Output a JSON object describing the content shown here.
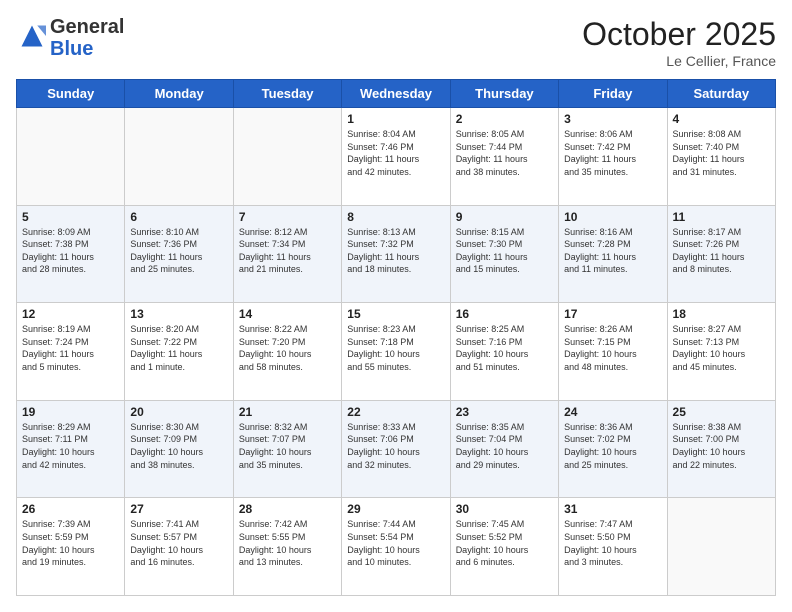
{
  "header": {
    "logo_general": "General",
    "logo_blue": "Blue",
    "month_title": "October 2025",
    "location": "Le Cellier, France"
  },
  "weekdays": [
    "Sunday",
    "Monday",
    "Tuesday",
    "Wednesday",
    "Thursday",
    "Friday",
    "Saturday"
  ],
  "weeks": [
    [
      {
        "day": "",
        "info": ""
      },
      {
        "day": "",
        "info": ""
      },
      {
        "day": "",
        "info": ""
      },
      {
        "day": "1",
        "info": "Sunrise: 8:04 AM\nSunset: 7:46 PM\nDaylight: 11 hours\nand 42 minutes."
      },
      {
        "day": "2",
        "info": "Sunrise: 8:05 AM\nSunset: 7:44 PM\nDaylight: 11 hours\nand 38 minutes."
      },
      {
        "day": "3",
        "info": "Sunrise: 8:06 AM\nSunset: 7:42 PM\nDaylight: 11 hours\nand 35 minutes."
      },
      {
        "day": "4",
        "info": "Sunrise: 8:08 AM\nSunset: 7:40 PM\nDaylight: 11 hours\nand 31 minutes."
      }
    ],
    [
      {
        "day": "5",
        "info": "Sunrise: 8:09 AM\nSunset: 7:38 PM\nDaylight: 11 hours\nand 28 minutes."
      },
      {
        "day": "6",
        "info": "Sunrise: 8:10 AM\nSunset: 7:36 PM\nDaylight: 11 hours\nand 25 minutes."
      },
      {
        "day": "7",
        "info": "Sunrise: 8:12 AM\nSunset: 7:34 PM\nDaylight: 11 hours\nand 21 minutes."
      },
      {
        "day": "8",
        "info": "Sunrise: 8:13 AM\nSunset: 7:32 PM\nDaylight: 11 hours\nand 18 minutes."
      },
      {
        "day": "9",
        "info": "Sunrise: 8:15 AM\nSunset: 7:30 PM\nDaylight: 11 hours\nand 15 minutes."
      },
      {
        "day": "10",
        "info": "Sunrise: 8:16 AM\nSunset: 7:28 PM\nDaylight: 11 hours\nand 11 minutes."
      },
      {
        "day": "11",
        "info": "Sunrise: 8:17 AM\nSunset: 7:26 PM\nDaylight: 11 hours\nand 8 minutes."
      }
    ],
    [
      {
        "day": "12",
        "info": "Sunrise: 8:19 AM\nSunset: 7:24 PM\nDaylight: 11 hours\nand 5 minutes."
      },
      {
        "day": "13",
        "info": "Sunrise: 8:20 AM\nSunset: 7:22 PM\nDaylight: 11 hours\nand 1 minute."
      },
      {
        "day": "14",
        "info": "Sunrise: 8:22 AM\nSunset: 7:20 PM\nDaylight: 10 hours\nand 58 minutes."
      },
      {
        "day": "15",
        "info": "Sunrise: 8:23 AM\nSunset: 7:18 PM\nDaylight: 10 hours\nand 55 minutes."
      },
      {
        "day": "16",
        "info": "Sunrise: 8:25 AM\nSunset: 7:16 PM\nDaylight: 10 hours\nand 51 minutes."
      },
      {
        "day": "17",
        "info": "Sunrise: 8:26 AM\nSunset: 7:15 PM\nDaylight: 10 hours\nand 48 minutes."
      },
      {
        "day": "18",
        "info": "Sunrise: 8:27 AM\nSunset: 7:13 PM\nDaylight: 10 hours\nand 45 minutes."
      }
    ],
    [
      {
        "day": "19",
        "info": "Sunrise: 8:29 AM\nSunset: 7:11 PM\nDaylight: 10 hours\nand 42 minutes."
      },
      {
        "day": "20",
        "info": "Sunrise: 8:30 AM\nSunset: 7:09 PM\nDaylight: 10 hours\nand 38 minutes."
      },
      {
        "day": "21",
        "info": "Sunrise: 8:32 AM\nSunset: 7:07 PM\nDaylight: 10 hours\nand 35 minutes."
      },
      {
        "day": "22",
        "info": "Sunrise: 8:33 AM\nSunset: 7:06 PM\nDaylight: 10 hours\nand 32 minutes."
      },
      {
        "day": "23",
        "info": "Sunrise: 8:35 AM\nSunset: 7:04 PM\nDaylight: 10 hours\nand 29 minutes."
      },
      {
        "day": "24",
        "info": "Sunrise: 8:36 AM\nSunset: 7:02 PM\nDaylight: 10 hours\nand 25 minutes."
      },
      {
        "day": "25",
        "info": "Sunrise: 8:38 AM\nSunset: 7:00 PM\nDaylight: 10 hours\nand 22 minutes."
      }
    ],
    [
      {
        "day": "26",
        "info": "Sunrise: 7:39 AM\nSunset: 5:59 PM\nDaylight: 10 hours\nand 19 minutes."
      },
      {
        "day": "27",
        "info": "Sunrise: 7:41 AM\nSunset: 5:57 PM\nDaylight: 10 hours\nand 16 minutes."
      },
      {
        "day": "28",
        "info": "Sunrise: 7:42 AM\nSunset: 5:55 PM\nDaylight: 10 hours\nand 13 minutes."
      },
      {
        "day": "29",
        "info": "Sunrise: 7:44 AM\nSunset: 5:54 PM\nDaylight: 10 hours\nand 10 minutes."
      },
      {
        "day": "30",
        "info": "Sunrise: 7:45 AM\nSunset: 5:52 PM\nDaylight: 10 hours\nand 6 minutes."
      },
      {
        "day": "31",
        "info": "Sunrise: 7:47 AM\nSunset: 5:50 PM\nDaylight: 10 hours\nand 3 minutes."
      },
      {
        "day": "",
        "info": ""
      }
    ]
  ]
}
